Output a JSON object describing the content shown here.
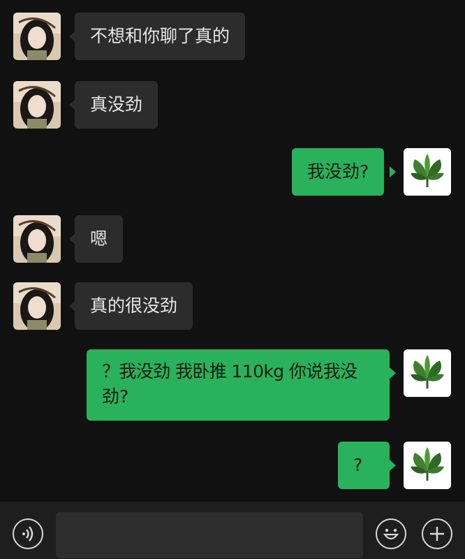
{
  "messages": [
    {
      "side": "in",
      "text": "不想和你聊了真的"
    },
    {
      "side": "in",
      "text": "真没劲"
    },
    {
      "side": "out",
      "text": "我没劲?"
    },
    {
      "side": "in",
      "text": "嗯"
    },
    {
      "side": "in",
      "text": "真的很没劲"
    },
    {
      "side": "out",
      "line1": "？我没劲 我卧推 110kg 你说我没",
      "line2": "劲?"
    },
    {
      "side": "out",
      "text": "?"
    }
  ],
  "avatars": {
    "left": "girl-avatar",
    "right": "green-plant-avatar"
  },
  "input_bar": {
    "voice_icon": "voice-icon",
    "emoji_icon": "emoji-icon",
    "plus_icon": "plus-icon"
  },
  "colors": {
    "background": "#111111",
    "incoming_bubble": "#2c2c2c",
    "outgoing_bubble": "#29b25b",
    "input_bar": "#1e1e1e"
  }
}
